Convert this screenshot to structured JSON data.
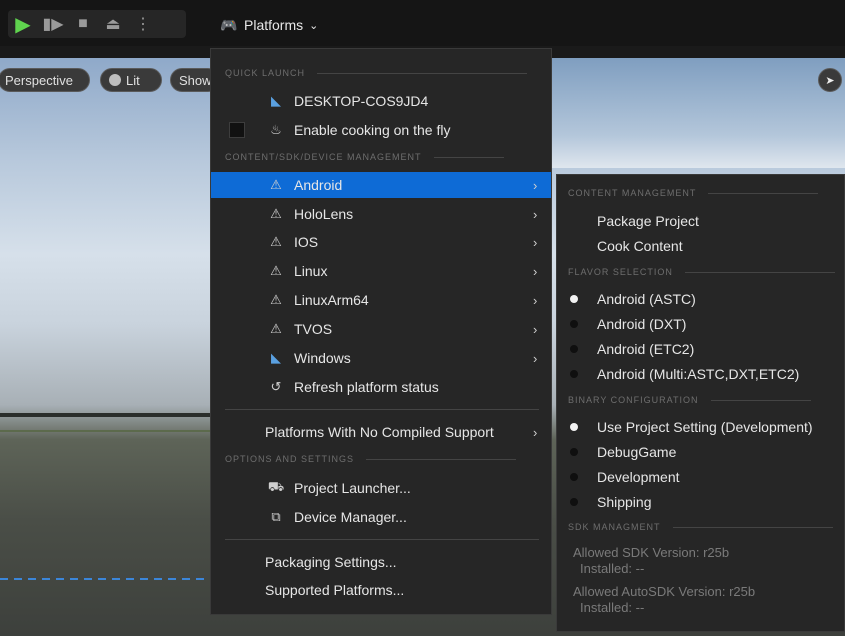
{
  "toolbar": {
    "platforms_label": "Platforms"
  },
  "viewport": {
    "perspective_label": "Perspective",
    "lit_label": "Lit",
    "show_label": "Show"
  },
  "menu": {
    "sections": {
      "quick_launch": "QUICK LAUNCH",
      "content_sdk": "CONTENT/SDK/DEVICE MANAGEMENT",
      "options": "OPTIONS AND SETTINGS"
    },
    "quick_launch": {
      "device": "DESKTOP-COS9JD4",
      "cooking": "Enable cooking on the fly"
    },
    "platforms": [
      {
        "label": "Android",
        "icon": "warning-icon"
      },
      {
        "label": "HoloLens",
        "icon": "warning-icon"
      },
      {
        "label": "IOS",
        "icon": "warning-icon"
      },
      {
        "label": "Linux",
        "icon": "warning-icon"
      },
      {
        "label": "LinuxArm64",
        "icon": "warning-icon"
      },
      {
        "label": "TVOS",
        "icon": "warning-icon"
      },
      {
        "label": "Windows",
        "icon": "windows-icon"
      }
    ],
    "refresh": "Refresh platform status",
    "no_compiled": "Platforms With No Compiled Support",
    "project_launcher": "Project Launcher...",
    "device_manager": "Device Manager...",
    "packaging_settings": "Packaging Settings...",
    "supported_platforms": "Supported Platforms..."
  },
  "submenu": {
    "sections": {
      "content": "CONTENT MANAGEMENT",
      "flavor": "FLAVOR SELECTION",
      "binary": "BINARY CONFIGURATION",
      "sdk": "SDK MANAGMENT"
    },
    "content": [
      "Package Project",
      "Cook Content"
    ],
    "flavors": [
      {
        "label": "Android (ASTC)",
        "selected": true
      },
      {
        "label": "Android (DXT)",
        "selected": false
      },
      {
        "label": "Android (ETC2)",
        "selected": false
      },
      {
        "label": "Android (Multi:ASTC,DXT,ETC2)",
        "selected": false
      }
    ],
    "binary": [
      {
        "label": "Use Project Setting (Development)",
        "selected": true
      },
      {
        "label": "DebugGame",
        "selected": false
      },
      {
        "label": "Development",
        "selected": false
      },
      {
        "label": "Shipping",
        "selected": false
      }
    ],
    "sdk": {
      "allowed_sdk": "Allowed SDK Version: r25b",
      "installed_1": "Installed: --",
      "allowed_autosdk": "Allowed AutoSDK Version: r25b",
      "installed_2": "Installed: --"
    }
  },
  "colors": {
    "accent": "#0e6bd6",
    "play": "#5fd34e"
  }
}
